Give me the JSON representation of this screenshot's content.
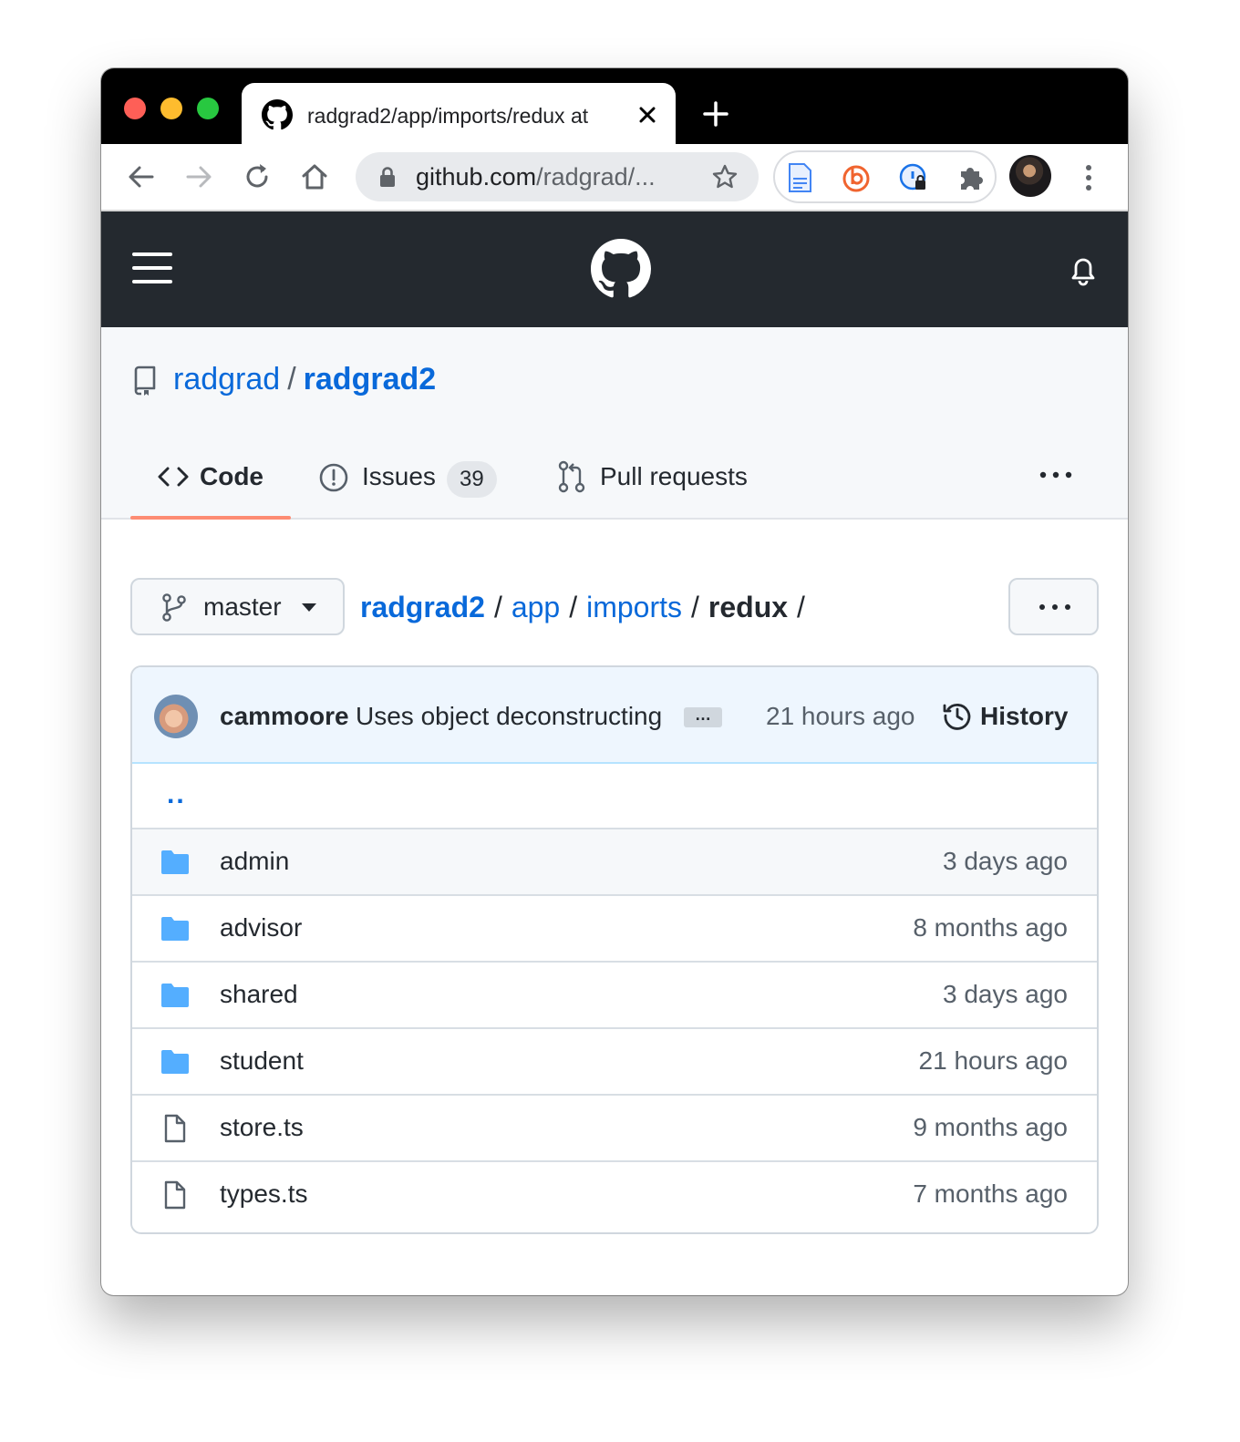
{
  "browser": {
    "tab_title": "radgrad2/app/imports/redux at",
    "url_domain": "github.com",
    "url_path": "/radgrad/..."
  },
  "repo": {
    "owner": "radgrad",
    "separator": "/",
    "name": "radgrad2"
  },
  "nav": {
    "code": "Code",
    "issues": "Issues",
    "issues_count": "39",
    "pull_requests": "Pull requests"
  },
  "branch": {
    "name": "master"
  },
  "breadcrumb": {
    "root": "radgrad2",
    "items": [
      "app",
      "imports"
    ],
    "current": "redux",
    "sep": "/"
  },
  "commit": {
    "author": "cammoore",
    "message": "Uses object deconstructing",
    "ellipsis": "…",
    "time": "21 hours ago",
    "history_label": "History"
  },
  "parent_link": "..",
  "files": [
    {
      "name": "admin",
      "type": "folder",
      "time": "3 days ago"
    },
    {
      "name": "advisor",
      "type": "folder",
      "time": "8 months ago"
    },
    {
      "name": "shared",
      "type": "folder",
      "time": "3 days ago"
    },
    {
      "name": "student",
      "type": "folder",
      "time": "21 hours ago"
    },
    {
      "name": "store.ts",
      "type": "file",
      "time": "9 months ago"
    },
    {
      "name": "types.ts",
      "type": "file",
      "time": "7 months ago"
    }
  ],
  "colors": {
    "link": "#0969da",
    "header_bg": "#24292f",
    "tab_underline": "#fd8c73",
    "folder": "#54aeff"
  },
  "icons": {
    "back": "arrow-left-icon",
    "forward": "arrow-right-icon",
    "reload": "reload-icon",
    "home": "home-icon",
    "bookmark": "star-icon",
    "repo": "repo-icon",
    "branch": "git-branch-icon",
    "folder": "folder-icon",
    "file": "file-icon"
  }
}
